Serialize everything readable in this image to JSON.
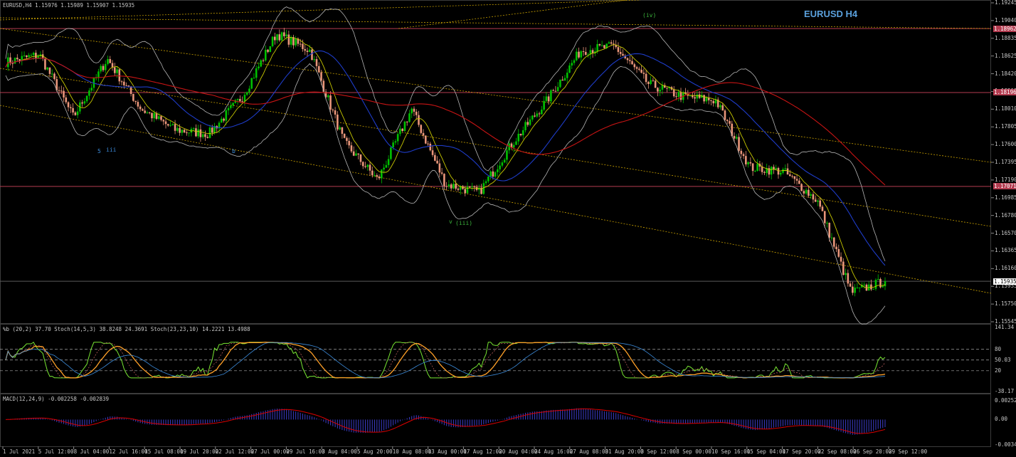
{
  "header": {
    "info": "EURUSD,H4  1.15976 1.15989 1.15907 1.15935",
    "symbol_title": "EURUSD H4"
  },
  "colors": {
    "background": "#000000",
    "bull": "#00c000",
    "bear": "#e9967a",
    "ma_red": "#c81414",
    "ma_blue": "#1e3cc8",
    "ma_yellow": "#c8c800",
    "bands": "#b4b4b4",
    "level_line": "#b43c50",
    "channel": "#c8a000",
    "stoch_green": "#78e632",
    "stoch_orange": "#ffa028",
    "stoch_blue": "#3c8cdc",
    "macd_hist": "#3c3cc8",
    "macd_signal": "#dc0000",
    "title_color": "#5aa0dc"
  },
  "main_axis": {
    "ticks": [
      "1.19245",
      "1.19040",
      "1.18835",
      "1.18625",
      "1.18420",
      "1.18215",
      "1.18010",
      "1.17805",
      "1.17600",
      "1.17395",
      "1.17190",
      "1.16985",
      "1.16780",
      "1.16570",
      "1.16365",
      "1.16160",
      "1.15955",
      "1.15750",
      "1.15545"
    ],
    "tags": [
      {
        "text": "1.18962",
        "bg": "#b43c50",
        "fg": "#ffffff",
        "value": 1.18962
      },
      {
        "text": "1.18196",
        "bg": "#b43c50",
        "fg": "#ffffff",
        "value": 1.18196
      },
      {
        "text": "1.17071",
        "bg": "#b43c50",
        "fg": "#ffffff",
        "value": 1.17071
      },
      {
        "text": "1.15935",
        "bg": "#ffffff",
        "fg": "#000000",
        "value": 1.15935
      }
    ]
  },
  "wave_labels": [
    {
      "text": "(iv)",
      "color": "#3cb43c"
    },
    {
      "text": "5",
      "color": "#3c8cdc"
    },
    {
      "text": "iii",
      "color": "#3c8cdc"
    },
    {
      "text": "b",
      "color": "#3c8cdc"
    },
    {
      "text": "v",
      "color": "#3cb43c"
    },
    {
      "text": "(iii)",
      "color": "#3cb43c"
    }
  ],
  "stoch_pane": {
    "label": "%b (20,2) 37.70  Stoch(14,5,3) 38.8248 24.3691  Stoch(23,23,10) 14.2221 13.4988",
    "ticks": [
      "141.34",
      "80",
      "50.03",
      "20",
      "-38.17"
    ]
  },
  "macd_pane": {
    "label": "MACD(12,24,9) -0.002258 -0.002839",
    "ticks": [
      "0.002527",
      "0.00",
      "-0.003406"
    ]
  },
  "x_axis": {
    "labels": [
      "1 Jul 2021",
      "5 Jul 12:00",
      "8 Jul 04:00",
      "12 Jul 16:00",
      "15 Jul 08:00",
      "19 Jul 20:00",
      "22 Jul 12:00",
      "27 Jul 00:00",
      "29 Jul 16:00",
      "3 Aug 04:00",
      "5 Aug 20:00",
      "10 Aug 08:00",
      "13 Aug 00:00",
      "17 Aug 12:00",
      "20 Aug 04:00",
      "24 Aug 16:00",
      "27 Aug 08:00",
      "31 Aug 20:00",
      "3 Sep 12:00",
      "8 Sep 00:00",
      "10 Sep 16:00",
      "15 Sep 04:00",
      "17 Sep 20:00",
      "22 Sep 08:00",
      "26 Sep 20:00",
      "29 Sep 12:00"
    ]
  },
  "chart_data": {
    "type": "candlestick",
    "title": "EURUSD H4",
    "symbol": "EURUSD",
    "timeframe": "H4",
    "ylim": [
      1.1545,
      1.1927
    ],
    "close_path": [
      {
        "x": "1 Jul 2021",
        "close": 1.1856
      },
      {
        "x": "5 Jul 12:00",
        "close": 1.1865
      },
      {
        "x": "8 Jul 04:00",
        "close": 1.179
      },
      {
        "x": "12 Jul 16:00",
        "close": 1.186
      },
      {
        "x": "15 Jul 08:00",
        "close": 1.18
      },
      {
        "x": "19 Jul 20:00",
        "close": 1.1775
      },
      {
        "x": "22 Jul 12:00",
        "close": 1.177
      },
      {
        "x": "27 Jul 00:00",
        "close": 1.1815
      },
      {
        "x": "29 Jul 16:00",
        "close": 1.189
      },
      {
        "x": "3 Aug 04:00",
        "close": 1.187
      },
      {
        "x": "5 Aug 20:00",
        "close": 1.176
      },
      {
        "x": "10 Aug 08:00",
        "close": 1.1715
      },
      {
        "x": "13 Aug 00:00",
        "close": 1.18
      },
      {
        "x": "17 Aug 12:00",
        "close": 1.171
      },
      {
        "x": "20 Aug 04:00",
        "close": 1.17
      },
      {
        "x": "24 Aug 16:00",
        "close": 1.176
      },
      {
        "x": "27 Aug 08:00",
        "close": 1.181
      },
      {
        "x": "31 Aug 20:00",
        "close": 1.187
      },
      {
        "x": "3 Sep 12:00",
        "close": 1.1875
      },
      {
        "x": "8 Sep 00:00",
        "close": 1.183
      },
      {
        "x": "10 Sep 16:00",
        "close": 1.1815
      },
      {
        "x": "15 Sep 04:00",
        "close": 1.181
      },
      {
        "x": "17 Sep 20:00",
        "close": 1.173
      },
      {
        "x": "22 Sep 08:00",
        "close": 1.1725
      },
      {
        "x": "26 Sep 20:00",
        "close": 1.169
      },
      {
        "x": "29 Sep 12:00",
        "close": 1.158
      },
      {
        "x": "30 Sep",
        "close": 1.15935
      }
    ],
    "horizontal_levels": [
      1.18962,
      1.18196,
      1.17071,
      1.15935
    ],
    "indicators": [
      "Bollinger Bands (20,2)",
      "Moving averages",
      "Stoch(14,5,3)",
      "Stoch(23,23,10)",
      "MACD(12,24,9)"
    ]
  }
}
